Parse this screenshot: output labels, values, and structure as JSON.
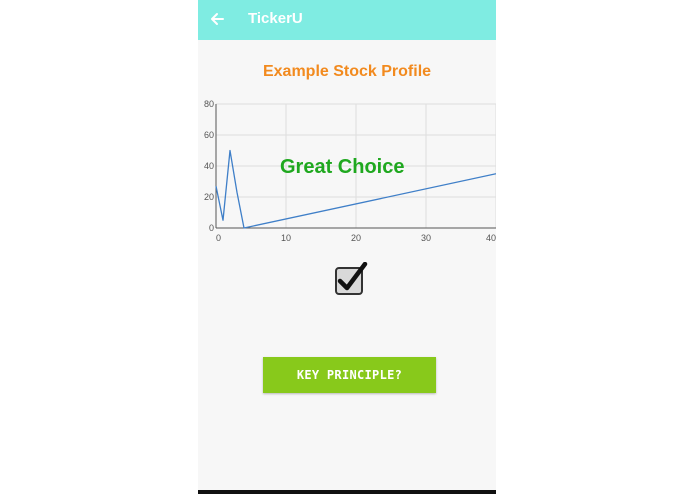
{
  "app": {
    "title": "TickerU",
    "back_icon": "arrow-left-icon",
    "appbar_color": "#7fece2"
  },
  "main": {
    "page_title": "Example Stock Profile",
    "verdict": "Great Choice",
    "checkbox_checked": true,
    "key_button_label": "KEY PRINCIPLE?"
  },
  "colors": {
    "title": "#f28a1e",
    "verdict": "#1fa81f",
    "button": "#88c91b",
    "line": "#3f7fc8"
  },
  "chart_data": {
    "type": "line",
    "x": [
      0,
      1,
      2,
      3,
      4,
      40
    ],
    "y": [
      27,
      5,
      50,
      23,
      0,
      35
    ],
    "xlim": [
      0,
      40
    ],
    "ylim": [
      0,
      80
    ],
    "x_ticks": [
      0,
      10,
      20,
      30,
      40
    ],
    "y_ticks": [
      0,
      20,
      40,
      60,
      80
    ],
    "x_tick_labels": [
      "0",
      "10",
      "20",
      "30",
      "40"
    ],
    "y_tick_labels": [
      "0",
      "20",
      "40",
      "60",
      "80"
    ],
    "grid": true,
    "title": "",
    "xlabel": "",
    "ylabel": ""
  }
}
